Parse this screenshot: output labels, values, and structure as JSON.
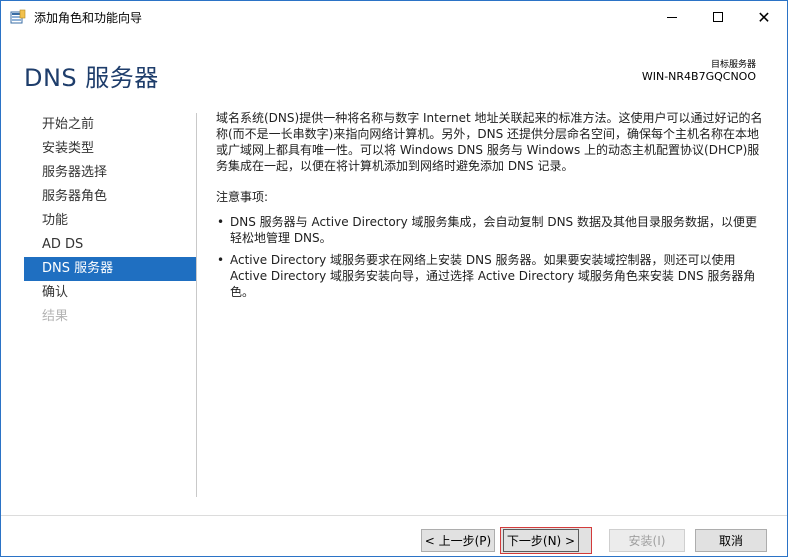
{
  "window": {
    "title": "添加角色和功能向导",
    "minimize_symbol": "",
    "close_symbol": "✕"
  },
  "header": {
    "page_title": "DNS 服务器",
    "target_label": "目标服务器",
    "target_name": "WIN-NR4B7GQCNOO"
  },
  "nav": {
    "items": [
      {
        "label": "开始之前"
      },
      {
        "label": "安装类型"
      },
      {
        "label": "服务器选择"
      },
      {
        "label": "服务器角色"
      },
      {
        "label": "功能"
      },
      {
        "label": "AD DS"
      },
      {
        "label": "DNS 服务器"
      },
      {
        "label": "确认"
      },
      {
        "label": "结果"
      }
    ]
  },
  "main": {
    "intro": "域名系统(DNS)提供一种将名称与数字 Internet 地址关联起来的标准方法。这使用户可以通过好记的名称(而不是一长串数字)来指向网络计算机。另外，DNS 还提供分层命名空间，确保每个主机名称在本地或广域网上都具有唯一性。可以将 Windows DNS 服务与 Windows 上的动态主机配置协议(DHCP)服务集成在一起，以便在将计算机添加到网络时避免添加 DNS 记录。",
    "notes_heading": "注意事项:",
    "bullet_symbol": "•",
    "notes": [
      "DNS 服务器与 Active Directory 域服务集成，会自动复制 DNS 数据及其他目录服务数据，以便更轻松地管理 DNS。",
      "Active Directory 域服务要求在网络上安装 DNS 服务器。如果要安装域控制器，则还可以使用 Active Directory 域服务安装向导，通过选择 Active Directory 域服务角色来安装 DNS 服务器角色。"
    ]
  },
  "footer": {
    "prev_label": "< 上一步(P)",
    "next_label": "下一步(N) >",
    "install_label": "安装(I)",
    "cancel_label": "取消"
  },
  "colors": {
    "accent": "#1f6fc1",
    "heading": "#1e3d6b",
    "highlight_border": "#d33b3b"
  },
  "icons": {
    "app": "server-manager-icon",
    "minimize": "minimize-icon",
    "maximize": "maximize-icon",
    "close": "close-icon"
  }
}
